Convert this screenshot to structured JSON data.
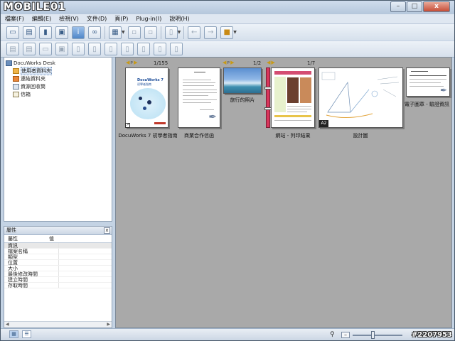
{
  "watermark": {
    "brand": "MOBILE01",
    "id": "#2207953"
  },
  "window_controls": {
    "minimize": "–",
    "maximize": "□",
    "close": "x"
  },
  "menu": [
    "檔案(F)",
    "編輯(E)",
    "檢視(V)",
    "文件(D)",
    "頁(P)",
    "Plug-in(I)",
    "說明(H)"
  ],
  "toolbar1_icons": [
    "scanner-icon",
    "printer-icon",
    "export-icon",
    "window-icon",
    "info-icon",
    "binoculars-icon",
    "grid-view-icon",
    "paste-icon",
    "clipboard-icon",
    "page-icon",
    "back-arrow-icon",
    "forward-arrow-icon",
    "folder-open-icon"
  ],
  "toolbar2_icons": [
    "bind-icon",
    "unbind-icon",
    "annotation-icon",
    "stack-icon",
    "copy-icon",
    "extract-icon",
    "rotate-icon",
    "merge-icon",
    "split-icon",
    "send-icon",
    "fax-icon"
  ],
  "tree": {
    "root": "DocuWorks Desk",
    "items": [
      "使用者資料夾",
      "連結資料夾",
      "資源回收筒",
      "信箱"
    ]
  },
  "properties": {
    "title": "屬性",
    "close": "x",
    "col_name": "屬性",
    "col_value": "值",
    "rows": [
      "資訊",
      "檔案名稱",
      "類型",
      "位置",
      "大小",
      "最後修改時間",
      "建立時間",
      "存取時間"
    ]
  },
  "desk": {
    "documents": [
      {
        "label": "DocuWorks 7 初學者指南",
        "pages": "1/155",
        "cover_title": "DocuWorks 7",
        "cover_sub": "初學者指南"
      },
      {
        "label": "商業合作信函"
      },
      {
        "label": "旅行的照片",
        "pages": "1/2"
      },
      {
        "label": "網站 - 列印結果",
        "pages": "1/7"
      },
      {
        "label": "設計圖",
        "badge": "A2"
      },
      {
        "label": "電子圖章 - 驗證資訊"
      }
    ]
  },
  "status": {
    "zoom_minus": "–"
  }
}
